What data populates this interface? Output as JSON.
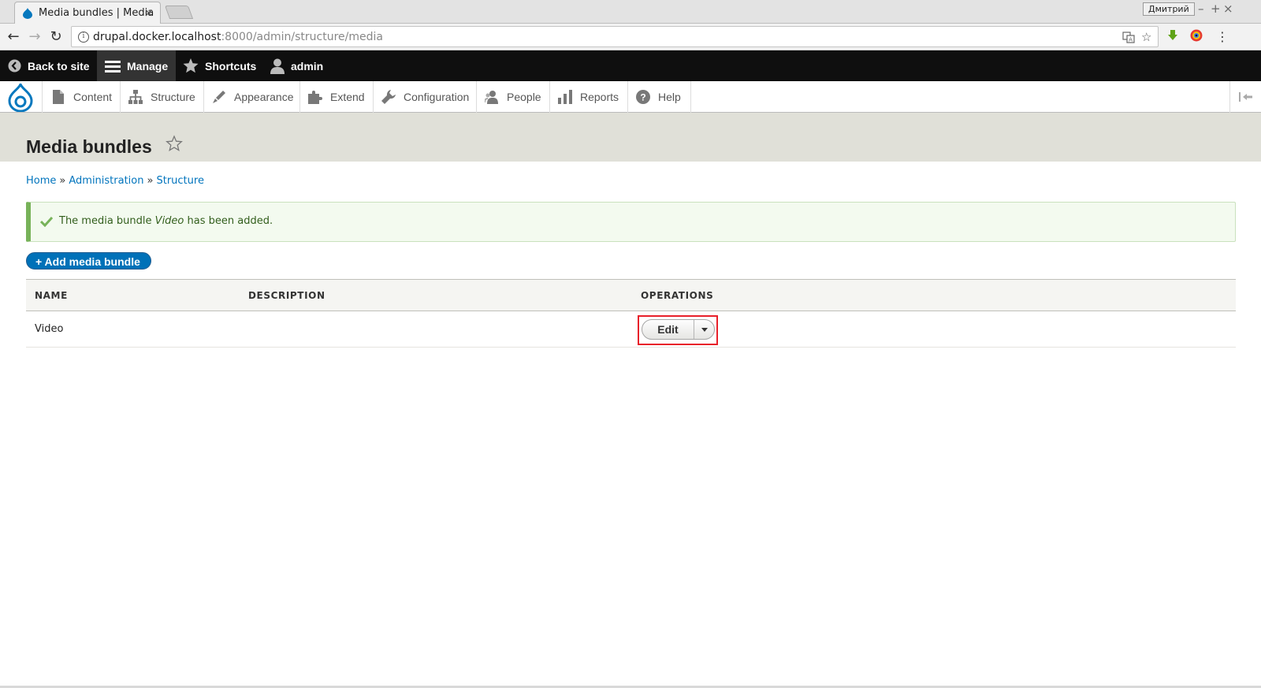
{
  "browser": {
    "tab_title": "Media bundles | Media",
    "tab_close": "×",
    "profile_name": "Дмитрий",
    "window_controls": [
      "–",
      "+",
      "×"
    ],
    "url_host": "drupal.docker.localhost",
    "url_rest": ":8000/admin/structure/media"
  },
  "admin_bar": {
    "back_to_site": "Back to site",
    "manage": "Manage",
    "shortcuts": "Shortcuts",
    "user": "admin"
  },
  "tray": {
    "items": [
      "Content",
      "Structure",
      "Appearance",
      "Extend",
      "Configuration",
      "People",
      "Reports",
      "Help"
    ],
    "icons": [
      "file-icon",
      "structure-icon",
      "appearance-icon",
      "extend-icon",
      "wrench-icon",
      "people-icon",
      "bar-chart-icon",
      "help-icon"
    ]
  },
  "page": {
    "title": "Media bundles",
    "breadcrumb": [
      "Home",
      "Administration",
      "Structure"
    ],
    "breadcrumb_sep": "»",
    "status_prefix": "The media bundle ",
    "status_name": "Video",
    "status_suffix": " has been added.",
    "add_button": "+ Add media bundle"
  },
  "table": {
    "headers": [
      "NAME",
      "DESCRIPTION",
      "OPERATIONS"
    ],
    "rows": [
      {
        "name": "Video",
        "description": "",
        "operation": "Edit"
      }
    ]
  },
  "colors": {
    "admin_bar_bg": "#0f0f0f",
    "link": "#0074bd",
    "primary_button": "#0071b8",
    "status_border": "#77b259",
    "highlight": "#e8202a"
  }
}
